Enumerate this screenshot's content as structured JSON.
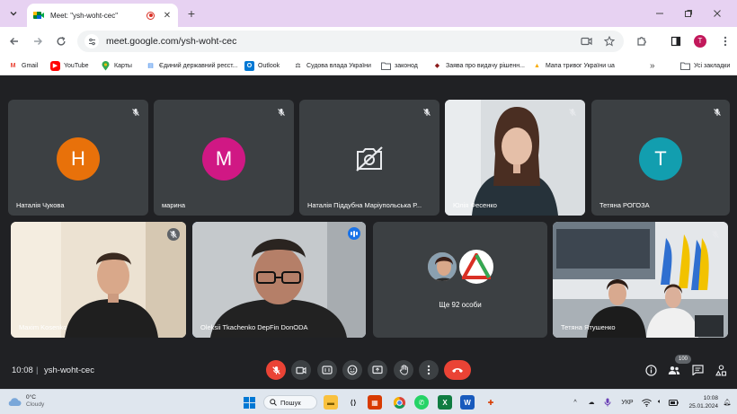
{
  "browser": {
    "tab_title": "Meet: \"ysh-woht-cec\"",
    "url": "meet.google.com/ysh-woht-cec",
    "profile_initial": "T"
  },
  "bookmarks": [
    {
      "label": "Gmail",
      "icon": "gmail-icon"
    },
    {
      "label": "YouTube",
      "icon": "youtube-icon"
    },
    {
      "label": "Карты",
      "icon": "maps-icon"
    },
    {
      "label": "Єдиний державний реєст...",
      "icon": "registry-icon"
    },
    {
      "label": "Outlook",
      "icon": "outlook-icon"
    },
    {
      "label": "Судова влада України",
      "icon": "court-icon"
    },
    {
      "label": "законод",
      "icon": "folder-icon"
    },
    {
      "label": "Заява про видачу рішенн...",
      "icon": "shield-icon"
    },
    {
      "label": "Мапа тривог України ua",
      "icon": "alert-map-icon"
    },
    {
      "label": "Усі закладки",
      "icon": "folder-icon"
    }
  ],
  "participants": [
    {
      "name": "Наталія Чукова",
      "initial": "Н",
      "color": "#e8710a"
    },
    {
      "name": "марина",
      "initial": "М",
      "color": "#d01884"
    },
    {
      "name": "Наталія Піддубна Маріупольська Р...",
      "camera_off": true
    },
    {
      "name": "Юлія Фесенко",
      "video": true
    },
    {
      "name": "Тетяна РОГОЗА",
      "initial": "Т",
      "color": "#129eaf"
    },
    {
      "name": "Maxim Kosenko",
      "video": true
    },
    {
      "name": "Oleksii Tkachenko DepFin DonODA",
      "video": true,
      "speaking": true
    },
    {
      "name": "Ще 92 особи",
      "overflow": true
    },
    {
      "name": "Тетяна Ятушенко",
      "video": true
    }
  ],
  "meeting": {
    "time": "10:08",
    "code": "ysh-woht-cec",
    "participant_count": "100"
  },
  "taskbar": {
    "temperature": "0°C",
    "weather": "Cloudy",
    "search_label": "Пошук",
    "lang": "УКР",
    "clock_time": "10:08",
    "clock_date": "25.01.2024"
  }
}
